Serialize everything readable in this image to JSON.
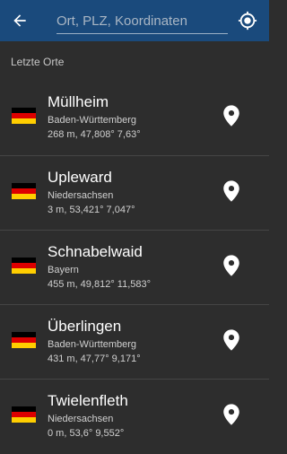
{
  "header": {
    "search_placeholder": "Ort, PLZ, Koordinaten",
    "back_icon": "arrow-left-icon",
    "locate_icon": "my-location-icon"
  },
  "section_title": "Letzte Orte",
  "places": [
    {
      "name": "Müllheim",
      "region": "Baden-Württemberg",
      "coords": "268 m, 47,808° 7,63°"
    },
    {
      "name": "Upleward",
      "region": "Niedersachsen",
      "coords": "3 m, 53,421° 7,047°"
    },
    {
      "name": "Schnabelwaid",
      "region": "Bayern",
      "coords": "455 m, 49,812° 11,583°"
    },
    {
      "name": "Überlingen",
      "region": "Baden-Württemberg",
      "coords": "431 m, 47,77° 9,171°"
    },
    {
      "name": "Twielenfleth",
      "region": "Niedersachsen",
      "coords": "0 m, 53,6° 9,552°"
    }
  ],
  "colors": {
    "appbar": "#1a4a7c",
    "background": "#2d2d2d",
    "flag_black": "#000000",
    "flag_red": "#dd0000",
    "flag_gold": "#ffce00"
  }
}
